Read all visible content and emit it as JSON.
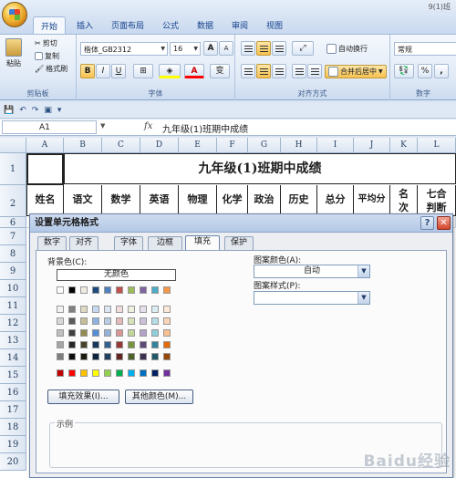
{
  "window": {
    "title": "9(1)班"
  },
  "ribbon_tabs": [
    "开始",
    "插入",
    "页面布局",
    "公式",
    "数据",
    "审阅",
    "视图"
  ],
  "clipboard": {
    "paste": "粘贴",
    "cut": "剪切",
    "copy": "复制",
    "format_painter": "格式刷",
    "label": "剪贴板"
  },
  "font": {
    "name": "楷体_GB2312",
    "size": "16",
    "grow": "A",
    "shrink": "A",
    "bold": "B",
    "italic": "I",
    "underline": "U",
    "color_a": "A",
    "phonetic": "变",
    "label": "字体"
  },
  "alignment": {
    "wrap": "自动换行",
    "merge": "合并后居中",
    "label": "对齐方式"
  },
  "number": {
    "format": "常规",
    "percent": "%",
    "comma": ",",
    "label": "数字"
  },
  "formula_bar": {
    "cell_ref": "A1",
    "fx": "fx",
    "content": "九年级(1)班期中成绩"
  },
  "columns": [
    "A",
    "B",
    "C",
    "D",
    "E",
    "F",
    "G",
    "H",
    "I",
    "J",
    "K",
    "L"
  ],
  "rows": [
    "1",
    "2",
    "6",
    "7",
    "8",
    "9",
    "10",
    "11",
    "12",
    "13",
    "14",
    "15",
    "16",
    "17",
    "18",
    "19",
    "20"
  ],
  "sheet": {
    "title": "九年级(1)班期中成绩",
    "headers": [
      "姓名",
      "语文",
      "数学",
      "英语",
      "物理",
      "化学",
      "政治",
      "历史",
      "总分",
      "平均分"
    ],
    "header_k": [
      "名",
      "次"
    ],
    "header_l": [
      "七合",
      "判断"
    ]
  },
  "dialog": {
    "title": "设置单元格格式",
    "help": "?",
    "close": "✕",
    "tabs": [
      "数字",
      "对齐",
      "字体",
      "边框",
      "填充",
      "保护"
    ],
    "active_tab": "填充",
    "background_color_label": "背景色(C):",
    "no_color": "无颜色",
    "pattern_color_label": "图案颜色(A):",
    "pattern_color_value": "自动",
    "pattern_style_label": "图案样式(P):",
    "pattern_style_value": "",
    "fill_effects": "填充效果(I)...",
    "more_colors": "其他颜色(M)...",
    "sample_label": "示例"
  },
  "palette": {
    "top_row": [
      "#ffffff",
      "#000000",
      "#eeece1",
      "#1f497d",
      "#4f81bd",
      "#c0504d",
      "#9bbb59",
      "#8064a2",
      "#4bacc6",
      "#f79646"
    ],
    "tints": [
      [
        "#f2f2f2",
        "#7f7f7f",
        "#ddd9c3",
        "#c6d9f0",
        "#dbe5f1",
        "#f2dcdb",
        "#ebf1dd",
        "#e5e0ec",
        "#dbeef3",
        "#fdeada"
      ],
      [
        "#d8d8d8",
        "#595959",
        "#c4bd97",
        "#8db3e2",
        "#b8cce4",
        "#e5b9b7",
        "#d7e3bc",
        "#ccc1d9",
        "#b7dde8",
        "#fbd5b5"
      ],
      [
        "#bfbfbf",
        "#3f3f3f",
        "#938953",
        "#548dd4",
        "#95b3d7",
        "#d99694",
        "#c3d69b",
        "#b2a2c7",
        "#92cddc",
        "#fac08f"
      ],
      [
        "#a5a5a5",
        "#262626",
        "#494429",
        "#17365d",
        "#366092",
        "#953734",
        "#76923c",
        "#5f497a",
        "#31859b",
        "#e36c09"
      ],
      [
        "#7f7f7f",
        "#0c0c0c",
        "#1d1b10",
        "#0f243e",
        "#244061",
        "#632423",
        "#4f6128",
        "#3f3151",
        "#205867",
        "#974806"
      ]
    ],
    "standard": [
      "#c00000",
      "#ff0000",
      "#ffc000",
      "#ffff00",
      "#92d050",
      "#00b050",
      "#00b0f0",
      "#0070c0",
      "#002060",
      "#7030a0"
    ]
  },
  "watermark": "Baidu经验"
}
